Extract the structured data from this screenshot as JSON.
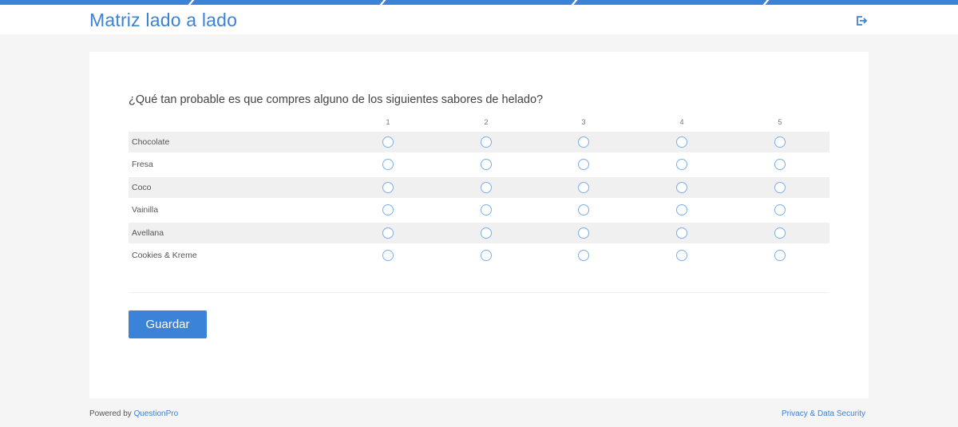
{
  "header": {
    "title": "Matriz lado a lado",
    "exit_icon": "exit-icon"
  },
  "survey": {
    "question": "¿Qué tan probable es que compres alguno de los siguientes sabores de helado?",
    "columns": [
      "1",
      "2",
      "3",
      "4",
      "5"
    ],
    "rows": [
      "Chocolate",
      "Fresa",
      "Coco",
      "Vainilla",
      "Avellana",
      "Cookies & Kreme"
    ],
    "save_label": "Guardar"
  },
  "footer": {
    "powered_by": "Powered by",
    "brand": "QuestionPro",
    "privacy": "Privacy & Data Security"
  },
  "colors": {
    "accent": "#3b82d9",
    "row_shade": "#f0f0f0",
    "background": "#f5f5f5"
  }
}
